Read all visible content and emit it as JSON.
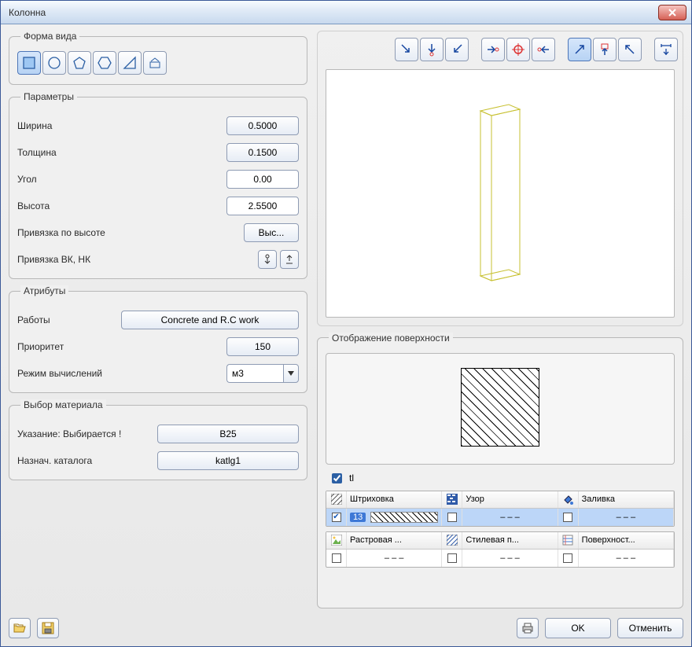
{
  "window": {
    "title": "Колонна"
  },
  "shape_group": {
    "legend": "Форма вида"
  },
  "params_group": {
    "legend": "Параметры",
    "width_label": "Ширина",
    "width_value": "0.5000",
    "thickness_label": "Толщина",
    "thickness_value": "0.1500",
    "angle_label": "Угол",
    "angle_value": "0.00",
    "height_label": "Высота",
    "height_value": "2.5500",
    "height_bind_label": "Привязка по высоте",
    "height_bind_btn": "Выс...",
    "vknk_label": "Привязка ВК, НК"
  },
  "attrs_group": {
    "legend": "Атрибуты",
    "works_label": "Работы",
    "works_value": "Concrete and R.C work",
    "priority_label": "Приоритет",
    "priority_value": "150",
    "calc_mode_label": "Режим вычислений",
    "calc_mode_value": "м3"
  },
  "material_group": {
    "legend": "Выбор материала",
    "selection_label": "Указание: Выбирается !",
    "selection_value": "B25",
    "catalog_label": "Назнач. каталога",
    "catalog_value": "katlg1"
  },
  "surface_group": {
    "legend": "Отображение поверхности",
    "tl_checked": true,
    "tl_label": "tl",
    "headers1": {
      "a": "Штриховка",
      "b": "Узор",
      "c": "Заливка"
    },
    "row1": {
      "a_checked": true,
      "a_val": "13",
      "b_val": "– – –",
      "c_val": "– – –"
    },
    "headers2": {
      "a": "Растровая ...",
      "b": "Стилевая п...",
      "c": "Поверхност..."
    },
    "row2": {
      "a_val": "– – –",
      "b_val": "– – –",
      "c_val": "– – –"
    }
  },
  "footer": {
    "ok": "OK",
    "cancel": "Отменить"
  }
}
